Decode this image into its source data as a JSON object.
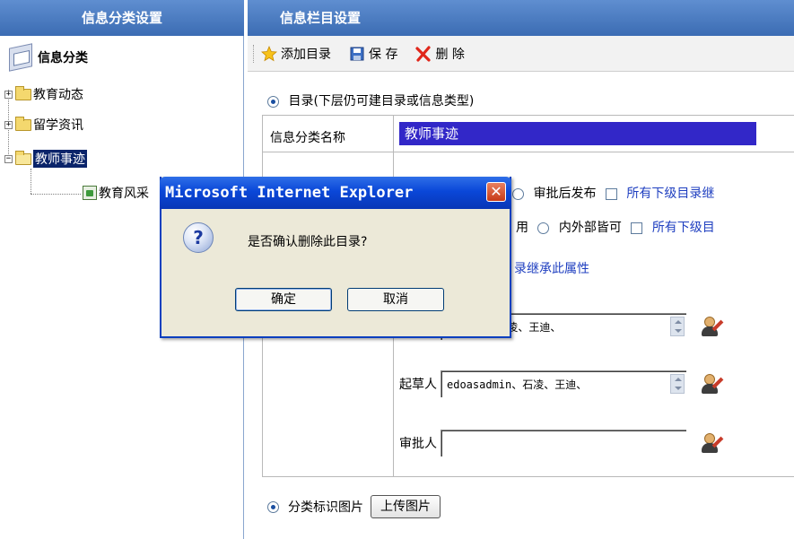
{
  "left_panel": {
    "title": "信息分类设置",
    "root_label": "信息分类",
    "tree": [
      {
        "label": "教育动态",
        "expander": "+"
      },
      {
        "label": "留学资讯",
        "expander": "+"
      },
      {
        "label": "教师事迹",
        "expander": "−",
        "selected": true
      },
      {
        "label": "教育风采",
        "child": true
      }
    ]
  },
  "right_panel": {
    "title": "信息栏目设置",
    "toolbar": {
      "add_label": "添加目录",
      "save_label": "保 存",
      "delete_label": "删 除"
    },
    "type_option": "目录(下层仍可建目录或信息类型)",
    "form": {
      "name_label": "信息分类名称",
      "name_value": "教师事迹",
      "publish_option": "审批后发布",
      "publish_inherit": "所有下级目录继",
      "scope_prefix": "用",
      "scope_option": "内外部皆可",
      "scope_inherit": "所有下级目",
      "inherit_attr": "录继承此属性",
      "publisher_value": "sadmin、石凌、王迪、",
      "drafter_label": "起草人",
      "drafter_value": "edoasadmin、石凌、王迪、",
      "approver_label": "审批人",
      "approver_value": ""
    },
    "image_option": "分类标识图片",
    "upload_button": "上传图片"
  },
  "dialog": {
    "title": "Microsoft Internet Explorer",
    "message": "是否确认删除此目录?",
    "ok_label": "确定",
    "cancel_label": "取消",
    "close_symbol": "✕",
    "icon_glyph": "?"
  }
}
